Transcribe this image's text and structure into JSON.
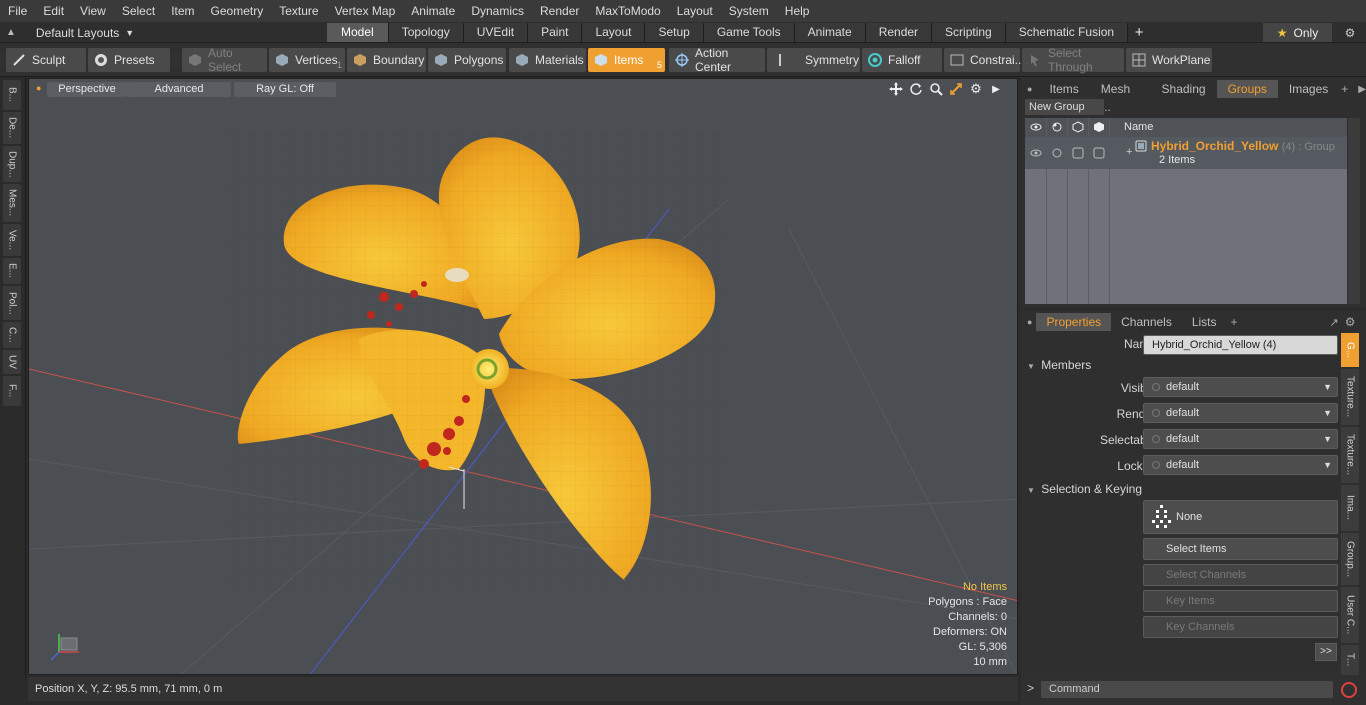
{
  "menu": [
    "File",
    "Edit",
    "View",
    "Select",
    "Item",
    "Geometry",
    "Texture",
    "Vertex Map",
    "Animate",
    "Dynamics",
    "Render",
    "MaxToModo",
    "Layout",
    "System",
    "Help"
  ],
  "layouts": {
    "label": "Default Layouts",
    "tabs": [
      "Model",
      "Topology",
      "UVEdit",
      "Paint",
      "Layout",
      "Setup",
      "Game Tools",
      "Animate",
      "Render",
      "Scripting",
      "Schematic Fusion"
    ],
    "active": "Model",
    "only_label": "Only",
    "plus": "+"
  },
  "toolbar": {
    "sculpt": "Sculpt",
    "presets": "Presets",
    "auto_select": "Auto Select",
    "vertices": "Vertices",
    "vertices_count": "1",
    "boundary": "Boundary",
    "polygons": "Polygons",
    "materials": "Materials",
    "items": "Items",
    "items_count": "5",
    "action_center": "Action Center",
    "symmetry": "Symmetry",
    "falloff": "Falloff",
    "constraints": "Constrai...",
    "select_through": "Select Through",
    "workplane": "WorkPlane"
  },
  "left_tabs": [
    "B...",
    "De...",
    "Dup...",
    "Mes...",
    "Ve...",
    "E...",
    "Pol...",
    "C...",
    "UV",
    "F..."
  ],
  "viewport": {
    "view": "Perspective",
    "shading": "Advanced",
    "raygl": "Ray GL: Off",
    "stats": {
      "no_items": "No Items",
      "polygons": "Polygons : Face",
      "channels": "Channels: 0",
      "deformers": "Deformers: ON",
      "gl": "GL: 5,306",
      "scale": "10 mm"
    }
  },
  "status": {
    "position": "Position X, Y, Z:   95.5 mm, 71 mm, 0 m"
  },
  "groups_panel": {
    "tabs": [
      "Items",
      "Mesh ...",
      "Shading",
      "Groups",
      "Images"
    ],
    "active": "Groups",
    "new_group": "New Group",
    "col_name": "Name",
    "row": {
      "name": "Hybrid_Orchid_Yellow",
      "suffix": "(4) : Group",
      "count": "2 Items"
    }
  },
  "properties": {
    "tabs": [
      "Properties",
      "Channels",
      "Lists"
    ],
    "active": "Properties",
    "name_label": "Name",
    "name_value": "Hybrid_Orchid_Yellow (4)",
    "members_section": "Members",
    "fields": [
      {
        "label": "Visible",
        "value": "default"
      },
      {
        "label": "Render",
        "value": "default"
      },
      {
        "label": "Selectable",
        "value": "default"
      },
      {
        "label": "Locked",
        "value": "default"
      }
    ],
    "selection_section": "Selection & Keying",
    "none_btn": "None",
    "select_items": "Select Items",
    "select_channels": "Select Channels",
    "key_items": "Key Items",
    "key_channels": "Key Channels",
    "more": ">>"
  },
  "side_tabs": [
    "G...",
    "Texture...",
    "Texture...",
    "Ima...",
    "Group...",
    "User C...",
    "T..."
  ],
  "command": {
    "placeholder": "Command",
    "prompt": ">"
  },
  "colors": {
    "accent": "#f0a030",
    "viewport_bg": "#4b4f54",
    "petal": "#f2b11e"
  }
}
